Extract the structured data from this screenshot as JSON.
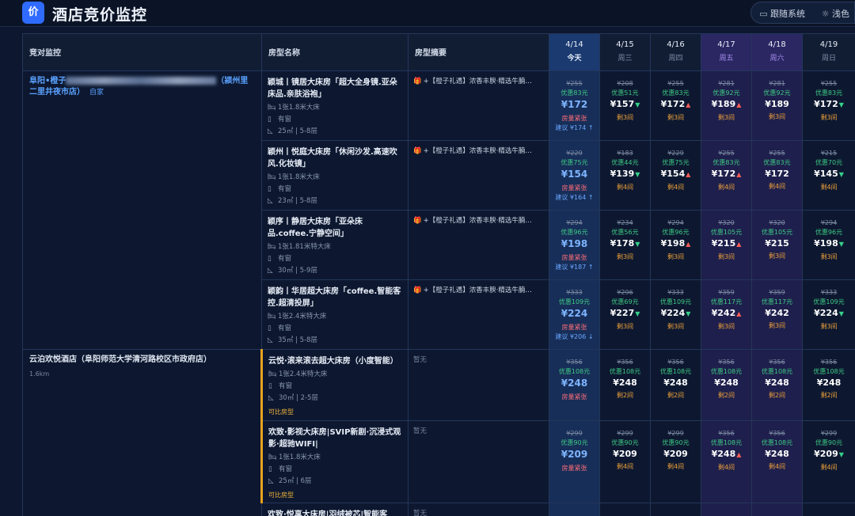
{
  "app": {
    "logo": "价",
    "title": "酒店竞价监控"
  },
  "theme": {
    "follow_system": "跟随系统",
    "light": "浅色",
    "system_icon": "monitor-icon",
    "light_icon": "sun-icon"
  },
  "columns": {
    "hotel": "竞对监控",
    "room": "房型名称",
    "summary": "房型摘要"
  },
  "dates": [
    {
      "date": "4/14",
      "weekday": "今天",
      "kind": "today"
    },
    {
      "date": "4/15",
      "weekday": "周三",
      "kind": "normal"
    },
    {
      "date": "4/16",
      "weekday": "周四",
      "kind": "normal"
    },
    {
      "date": "4/17",
      "weekday": "周五",
      "kind": "weekend"
    },
    {
      "date": "4/18",
      "weekday": "周六",
      "kind": "weekend"
    },
    {
      "date": "4/19",
      "weekday": "周日",
      "kind": "normal"
    }
  ],
  "colors": {
    "accent": "#2f6bff",
    "up": "#ff5d57",
    "down": "#37d08a",
    "discount": "#3ecb84",
    "remaining": "#f0a23a"
  },
  "hotels": [
    {
      "name_prefix": "阜阳•橙子",
      "name_suffix": "（颍州里二里井夜市店）",
      "tag": "自家",
      "distance": "",
      "rooms": [
        {
          "name": "颖城丨镜居大床房「超大全身镜.亚朵床品.亲肤浴袍」",
          "bed": "1张1.8米大床",
          "window": "有窗",
          "area": "25㎡ | 5-8层",
          "compare": "",
          "summary": "+【橙子礼遇】浓香丰腴·精选牛腩…",
          "prices": [
            {
              "orig": "¥255",
              "disc": "优惠83元",
              "cur": "¥172",
              "status": "房量紧张",
              "suggest": "建议 ¥174 ↑"
            },
            {
              "orig": "¥208",
              "disc": "优惠51元",
              "cur": "¥157",
              "trend": "down",
              "left": "剩3间"
            },
            {
              "orig": "¥255",
              "disc": "优惠83元",
              "cur": "¥172",
              "trend": "up",
              "left": "剩3间"
            },
            {
              "orig": "¥281",
              "disc": "优惠92元",
              "cur": "¥189",
              "trend": "up",
              "left": "剩3间"
            },
            {
              "orig": "¥281",
              "disc": "优惠92元",
              "cur": "¥189",
              "left": "剩3间"
            },
            {
              "orig": "¥255",
              "disc": "优惠83元",
              "cur": "¥172",
              "trend": "down",
              "left": "剩3间"
            }
          ]
        },
        {
          "name": "颖州丨悦庭大床房「休闲沙发.高速吹风.化妆镜」",
          "bed": "1张1.8米大床",
          "window": "有窗",
          "area": "23㎡ | 5-8层",
          "compare": "",
          "summary": "+【橙子礼遇】浓香丰腴·精选牛腩…",
          "prices": [
            {
              "orig": "¥229",
              "disc": "优惠75元",
              "cur": "¥154",
              "status": "房量紧张",
              "suggest": "建议 ¥164 ↑"
            },
            {
              "orig": "¥183",
              "disc": "优惠44元",
              "cur": "¥139",
              "trend": "down",
              "left": "剩4间"
            },
            {
              "orig": "¥229",
              "disc": "优惠75元",
              "cur": "¥154",
              "trend": "up",
              "left": "剩4间"
            },
            {
              "orig": "¥255",
              "disc": "优惠83元",
              "cur": "¥172",
              "trend": "up",
              "left": "剩4间"
            },
            {
              "orig": "¥255",
              "disc": "优惠83元",
              "cur": "¥172",
              "left": "剩4间"
            },
            {
              "orig": "¥215",
              "disc": "优惠70元",
              "cur": "¥145",
              "trend": "down",
              "left": "剩4间"
            }
          ]
        },
        {
          "name": "颖序丨静居大床房「亚朵床品.coffee.宁静空间」",
          "bed": "1张1.81米特大床",
          "window": "有窗",
          "area": "30㎡ | 5-9层",
          "compare": "",
          "summary": "+【橙子礼遇】浓香丰腴·精选牛腩…",
          "prices": [
            {
              "orig": "¥294",
              "disc": "优惠96元",
              "cur": "¥198",
              "status": "房量紧张",
              "suggest": "建议 ¥187 ↑"
            },
            {
              "orig": "¥234",
              "disc": "优惠56元",
              "cur": "¥178",
              "trend": "down",
              "left": "剩3间"
            },
            {
              "orig": "¥294",
              "disc": "优惠96元",
              "cur": "¥198",
              "trend": "up",
              "left": "剩3间"
            },
            {
              "orig": "¥320",
              "disc": "优惠105元",
              "cur": "¥215",
              "trend": "up",
              "left": "剩3间"
            },
            {
              "orig": "¥320",
              "disc": "优惠105元",
              "cur": "¥215",
              "left": "剩3间"
            },
            {
              "orig": "¥294",
              "disc": "优惠96元",
              "cur": "¥198",
              "trend": "down",
              "left": "剩3间"
            }
          ]
        },
        {
          "name": "颖韵丨华居超大床房「coffee.智能客控.超清投屏」",
          "bed": "1张2.4米特大床",
          "window": "有窗",
          "area": "35㎡ | 5-8层",
          "compare": "",
          "summary": "+【橙子礼遇】浓香丰腴·精选牛腩…",
          "prices": [
            {
              "orig": "¥333",
              "disc": "优惠109元",
              "cur": "¥224",
              "status": "房量紧张",
              "suggest": "建议 ¥206 ↓"
            },
            {
              "orig": "¥296",
              "disc": "优惠69元",
              "cur": "¥227",
              "trend": "down",
              "left": "剩3间"
            },
            {
              "orig": "¥333",
              "disc": "优惠109元",
              "cur": "¥224",
              "trend": "down",
              "left": "剩3间"
            },
            {
              "orig": "¥359",
              "disc": "优惠117元",
              "cur": "¥242",
              "trend": "up",
              "left": "剩3间"
            },
            {
              "orig": "¥359",
              "disc": "优惠117元",
              "cur": "¥242",
              "left": "剩3间"
            },
            {
              "orig": "¥333",
              "disc": "优惠109元",
              "cur": "¥224",
              "trend": "down",
              "left": "剩3间"
            }
          ]
        }
      ]
    },
    {
      "name_prefix": "云泊欢悦酒店（阜阳师范大学清河路校区市政府店）",
      "name_suffix": "",
      "tag": "",
      "distance": "1.6km",
      "rooms": [
        {
          "name": "云悦·滚来滚去超大床房（小度智能）",
          "bed": "1张2.4米特大床",
          "window": "有窗",
          "area": "30㎡ | 2-5层",
          "compare": "可比房型",
          "summary": "暂无",
          "prices": [
            {
              "orig": "¥356",
              "disc": "优惠108元",
              "cur": "¥248",
              "status": "房量紧张"
            },
            {
              "orig": "¥356",
              "disc": "优惠108元",
              "cur": "¥248",
              "left": "剩2间"
            },
            {
              "orig": "¥356",
              "disc": "优惠108元",
              "cur": "¥248",
              "left": "剩2间"
            },
            {
              "orig": "¥356",
              "disc": "优惠108元",
              "cur": "¥248",
              "left": "剩2间"
            },
            {
              "orig": "¥356",
              "disc": "优惠108元",
              "cur": "¥248",
              "left": "剩2间"
            },
            {
              "orig": "¥356",
              "disc": "优惠108元",
              "cur": "¥248",
              "left": "剩2间"
            }
          ]
        },
        {
          "name": "欢致·影视大床房|SVIP新剧·沉浸式观影·超驰WIFI|",
          "bed": "1张1.8米大床",
          "window": "有窗",
          "area": "25㎡ | 6层",
          "compare": "可比房型",
          "summary": "暂无",
          "prices": [
            {
              "orig": "¥299",
              "disc": "优惠90元",
              "cur": "¥209",
              "status": "房量紧张"
            },
            {
              "orig": "¥299",
              "disc": "优惠90元",
              "cur": "¥209",
              "left": "剩4间"
            },
            {
              "orig": "¥299",
              "disc": "优惠90元",
              "cur": "¥209",
              "left": "剩4间"
            },
            {
              "orig": "¥356",
              "disc": "优惠108元",
              "cur": "¥248",
              "trend": "up",
              "left": "剩4间"
            },
            {
              "orig": "¥356",
              "disc": "优惠108元",
              "cur": "¥248",
              "left": "剩4间"
            },
            {
              "orig": "¥299",
              "disc": "优惠90元",
              "cur": "¥209",
              "trend": "down",
              "left": "剩4间"
            }
          ]
        },
        {
          "name": "欢致·悦享大床房|羽绒被芯|智能客",
          "bed": "",
          "window": "",
          "area": "",
          "compare": "",
          "summary": "暂无",
          "prices": [
            {},
            {},
            {},
            {},
            {},
            {}
          ]
        }
      ]
    }
  ]
}
